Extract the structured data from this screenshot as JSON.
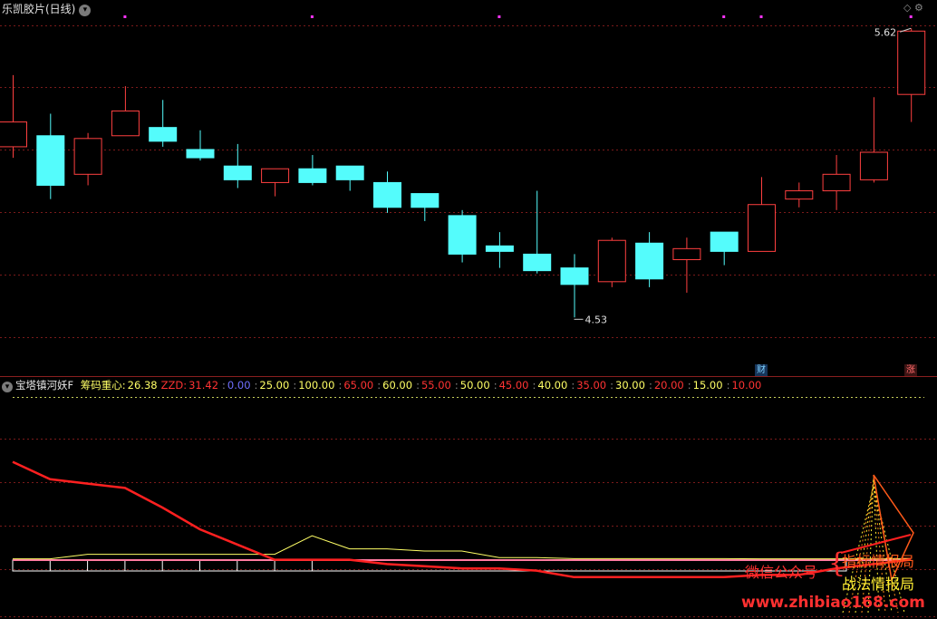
{
  "title": "乐凯胶片(日线)",
  "top_icons": "◇ ⚙",
  "price_labels": {
    "high": "5.62",
    "low": "4.53"
  },
  "badges": {
    "cai": "财",
    "zhang": "涨"
  },
  "indicator": {
    "name": "宝塔镇河妖F",
    "items": [
      {
        "label": "筹码重心:",
        "value": "26.38",
        "color": "#ffff66",
        "lcolor": "#ffff66"
      },
      {
        "label": "ZZD:",
        "value": "31.42",
        "color": "#ff3333",
        "lcolor": "#ff3333"
      },
      {
        "label": ":",
        "value": "0.00",
        "color": "#7070ff",
        "lcolor": "#888888"
      },
      {
        "label": ":",
        "value": "25.00",
        "color": "#ffff66",
        "lcolor": "#888888"
      },
      {
        "label": ":",
        "value": "100.00",
        "color": "#ffff66",
        "lcolor": "#888888"
      },
      {
        "label": ":",
        "value": "65.00",
        "color": "#ff3333",
        "lcolor": "#888888"
      },
      {
        "label": ":",
        "value": "60.00",
        "color": "#ffff66",
        "lcolor": "#888888"
      },
      {
        "label": ":",
        "value": "55.00",
        "color": "#ff3333",
        "lcolor": "#888888"
      },
      {
        "label": ":",
        "value": "50.00",
        "color": "#ffff66",
        "lcolor": "#888888"
      },
      {
        "label": ":",
        "value": "45.00",
        "color": "#ff3333",
        "lcolor": "#888888"
      },
      {
        "label": ":",
        "value": "40.00",
        "color": "#ffff66",
        "lcolor": "#888888"
      },
      {
        "label": ":",
        "value": "35.00",
        "color": "#ff3333",
        "lcolor": "#888888"
      },
      {
        "label": ":",
        "value": "30.00",
        "color": "#ffff66",
        "lcolor": "#888888"
      },
      {
        "label": ":",
        "value": "20.00",
        "color": "#ff3333",
        "lcolor": "#888888"
      },
      {
        "label": ":",
        "value": "15.00",
        "color": "#ffff66",
        "lcolor": "#888888"
      },
      {
        "label": ":",
        "value": "10.00",
        "color": "#ff3333",
        "lcolor": "#888888"
      }
    ]
  },
  "watermarks": {
    "wechat": "微信公众号",
    "line1": "指标情报局",
    "line2": "战法情报局",
    "url": "www.zhibiao168.com",
    "brace": "{"
  },
  "colors": {
    "up": "#ff4040",
    "down": "#54fcfc",
    "grid": "#7a1a1a",
    "zzd": "#ff2020",
    "center": "#ffff66",
    "base": "#ff7aa0",
    "signal": "#ff33ff"
  },
  "chart_data": {
    "type": "candlestick",
    "price_range": [
      4.4,
      5.7
    ],
    "candles": [
      {
        "o": 5.2,
        "c": 5.29,
        "h": 5.46,
        "l": 5.16
      },
      {
        "o": 5.24,
        "c": 5.06,
        "h": 5.32,
        "l": 5.01
      },
      {
        "o": 5.1,
        "c": 5.23,
        "h": 5.25,
        "l": 5.06
      },
      {
        "o": 5.24,
        "c": 5.33,
        "h": 5.42,
        "l": 5.24
      },
      {
        "o": 5.27,
        "c": 5.22,
        "h": 5.37,
        "l": 5.2
      },
      {
        "o": 5.19,
        "c": 5.16,
        "h": 5.26,
        "l": 5.15
      },
      {
        "o": 5.13,
        "c": 5.08,
        "h": 5.21,
        "l": 5.05
      },
      {
        "o": 5.07,
        "c": 5.12,
        "h": 5.12,
        "l": 5.02
      },
      {
        "o": 5.12,
        "c": 5.07,
        "h": 5.17,
        "l": 5.06
      },
      {
        "o": 5.13,
        "c": 5.08,
        "h": 5.13,
        "l": 5.04
      },
      {
        "o": 5.07,
        "c": 4.98,
        "h": 5.11,
        "l": 4.96
      },
      {
        "o": 5.03,
        "c": 4.98,
        "h": 5.03,
        "l": 4.93
      },
      {
        "o": 4.95,
        "c": 4.81,
        "h": 4.97,
        "l": 4.78
      },
      {
        "o": 4.84,
        "c": 4.82,
        "h": 4.89,
        "l": 4.76
      },
      {
        "o": 4.81,
        "c": 4.75,
        "h": 5.04,
        "l": 4.74
      },
      {
        "o": 4.76,
        "c": 4.7,
        "h": 4.81,
        "l": 4.58
      },
      {
        "o": 4.71,
        "c": 4.86,
        "h": 4.87,
        "l": 4.69
      },
      {
        "o": 4.85,
        "c": 4.72,
        "h": 4.89,
        "l": 4.69
      },
      {
        "o": 4.79,
        "c": 4.83,
        "h": 4.87,
        "l": 4.67
      },
      {
        "o": 4.89,
        "c": 4.82,
        "h": 4.89,
        "l": 4.77
      },
      {
        "o": 4.82,
        "c": 4.99,
        "h": 5.09,
        "l": 4.82
      },
      {
        "o": 5.01,
        "c": 5.04,
        "h": 5.07,
        "l": 4.98
      },
      {
        "o": 5.04,
        "c": 5.1,
        "h": 5.17,
        "l": 4.97
      },
      {
        "o": 5.08,
        "c": 5.18,
        "h": 5.38,
        "l": 5.07
      },
      {
        "o": 5.39,
        "c": 5.62,
        "h": 5.63,
        "l": 5.29
      }
    ],
    "signal_marks": [
      3,
      8,
      13,
      19,
      20,
      24
    ],
    "indicator_range": [
      0,
      100
    ],
    "zzd": [
      71,
      63,
      61,
      59,
      50,
      40,
      33,
      26,
      26,
      26,
      24,
      23,
      22,
      22,
      21,
      18,
      18,
      18,
      18,
      18,
      19,
      19,
      22,
      24,
      26
    ],
    "chip_center": [
      26.4,
      26.4,
      28.5,
      28.5,
      28.5,
      28.5,
      28.5,
      28.5,
      37,
      31,
      31,
      30,
      30,
      27,
      27,
      26.5,
      26.5,
      26.5,
      26.5,
      26.5,
      26.4,
      26.4,
      26.4,
      26.4,
      26.4
    ]
  }
}
